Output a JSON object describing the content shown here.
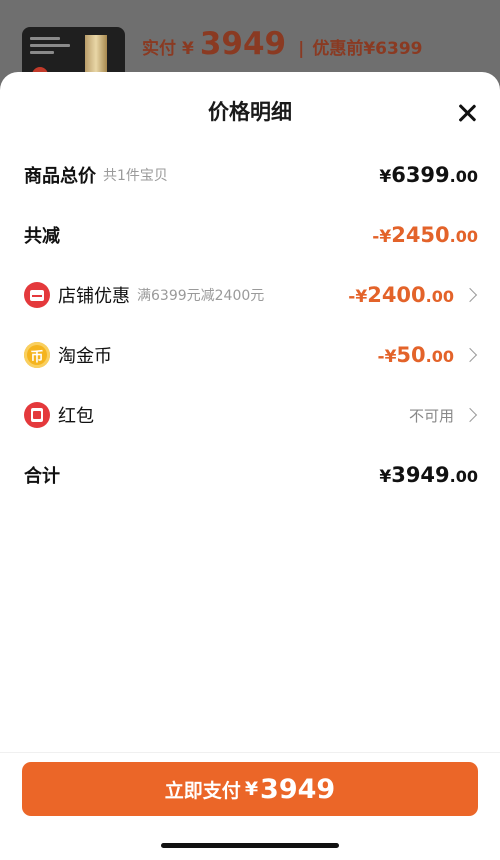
{
  "background": {
    "paid_label": "实付",
    "yen": "¥",
    "paid_amount": "3949",
    "separator": "|",
    "before_discount": "优惠前¥6399"
  },
  "sheet": {
    "title": "价格明细",
    "rows": [
      {
        "label": "商品总价",
        "sub": "共1件宝贝",
        "yen": "¥",
        "int": "6399",
        "dec": ".00",
        "tone": "black"
      },
      {
        "label": "共减",
        "sign": "-",
        "yen": "¥",
        "int": "2450",
        "dec": ".00",
        "tone": "orange"
      },
      {
        "label": "店铺优惠",
        "sub": "满6399元减2400元",
        "sign": "-",
        "yen": "¥",
        "int": "2400",
        "dec": ".00",
        "tone": "orange",
        "icon": "shop-icon"
      },
      {
        "label": "淘金币",
        "sign": "-",
        "yen": "¥",
        "int": "50",
        "dec": ".00",
        "tone": "orange",
        "icon": "coin-icon",
        "icon_glyph": "币"
      },
      {
        "label": "红包",
        "status": "不可用",
        "icon": "red-packet-icon"
      },
      {
        "label": "合计",
        "yen": "¥",
        "int": "3949",
        "dec": ".00",
        "tone": "black"
      }
    ]
  },
  "pay_button": {
    "label": "立即支付",
    "yen": "¥",
    "amount": "3949"
  },
  "colors": {
    "accent": "#eb6628",
    "discount": "#e3632a",
    "shop_icon": "#e4393c",
    "coin_icon": "#f5b41d"
  }
}
